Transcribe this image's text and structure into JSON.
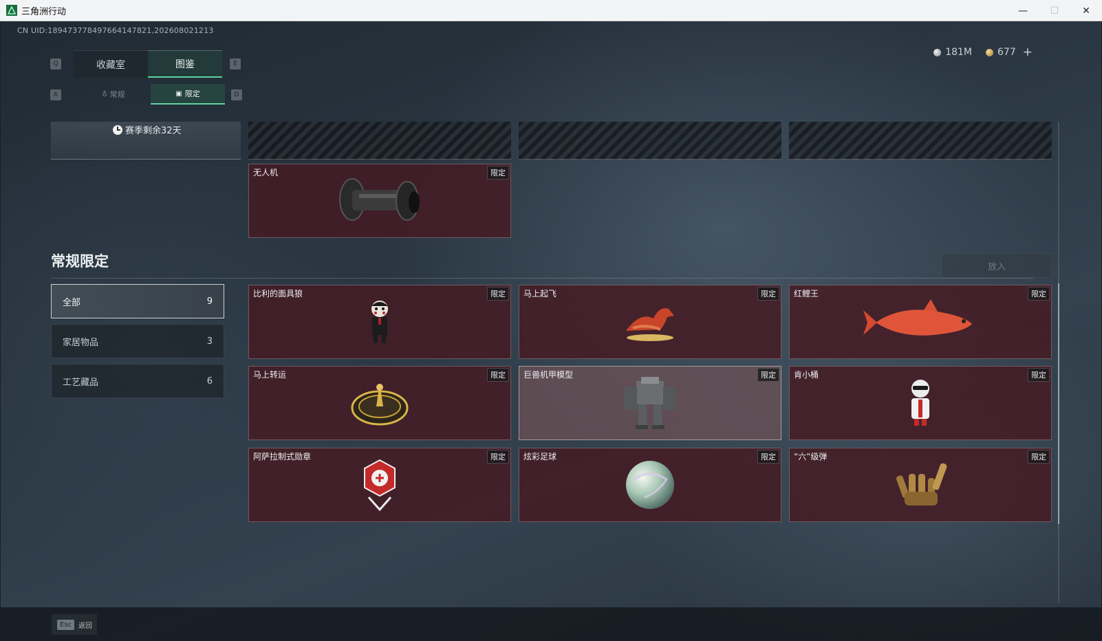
{
  "window": {
    "title": "三角洲行动",
    "controls": {
      "minimize": "—",
      "maximize": "☐",
      "close": "✕"
    }
  },
  "uid": "CN UID:1894737784976641478​21,202608021213",
  "currency": [
    {
      "icon": "silver-coin-icon",
      "value": "181M"
    },
    {
      "icon": "gold-coin-icon",
      "value": "677"
    }
  ],
  "currency_add": "+",
  "keys": {
    "prev_tab": "Q",
    "next_tab": "E",
    "prev_sub": "A",
    "next_sub": "D"
  },
  "tabs": [
    {
      "label": "收藏室",
      "active": false
    },
    {
      "label": "图鉴",
      "active": true
    }
  ],
  "subtabs": [
    {
      "label": "常规",
      "icon": "flask-icon",
      "active": false
    },
    {
      "label": "限定",
      "icon": "image-icon",
      "active": true
    }
  ],
  "season": {
    "text": "赛季剩余32天"
  },
  "top_card": {
    "name": "无人机",
    "badge": "限定",
    "icon": "drone-icon"
  },
  "section": {
    "title": "常规限定",
    "put_button": "放入"
  },
  "categories": [
    {
      "label": "全部",
      "count": "9",
      "active": true
    },
    {
      "label": "家居物品",
      "count": "3",
      "active": false
    },
    {
      "label": "工艺藏品",
      "count": "6",
      "active": false
    }
  ],
  "items": [
    {
      "name": "比利的面具狼",
      "badge": "限定",
      "icon": "puppet-icon"
    },
    {
      "name": "马上起飞",
      "badge": "限定",
      "icon": "horse-icon"
    },
    {
      "name": "红鲤王",
      "badge": "限定",
      "icon": "koi-fish-icon"
    },
    {
      "name": "马上转运",
      "badge": "限定",
      "icon": "compass-icon"
    },
    {
      "name": "巨兽机甲模型",
      "badge": "限定",
      "icon": "mech-icon"
    },
    {
      "name": "肯小桶",
      "badge": "限定",
      "icon": "figure-icon"
    },
    {
      "name": "阿萨拉制式勋章",
      "badge": "限定",
      "icon": "medal-icon"
    },
    {
      "name": "炫彩足球",
      "badge": "限定",
      "icon": "ball-icon"
    },
    {
      "name": "“六”级弹",
      "badge": "限定",
      "icon": "hand-icon"
    }
  ],
  "footer": {
    "esc_key": "Esc",
    "back_label": "返回"
  }
}
